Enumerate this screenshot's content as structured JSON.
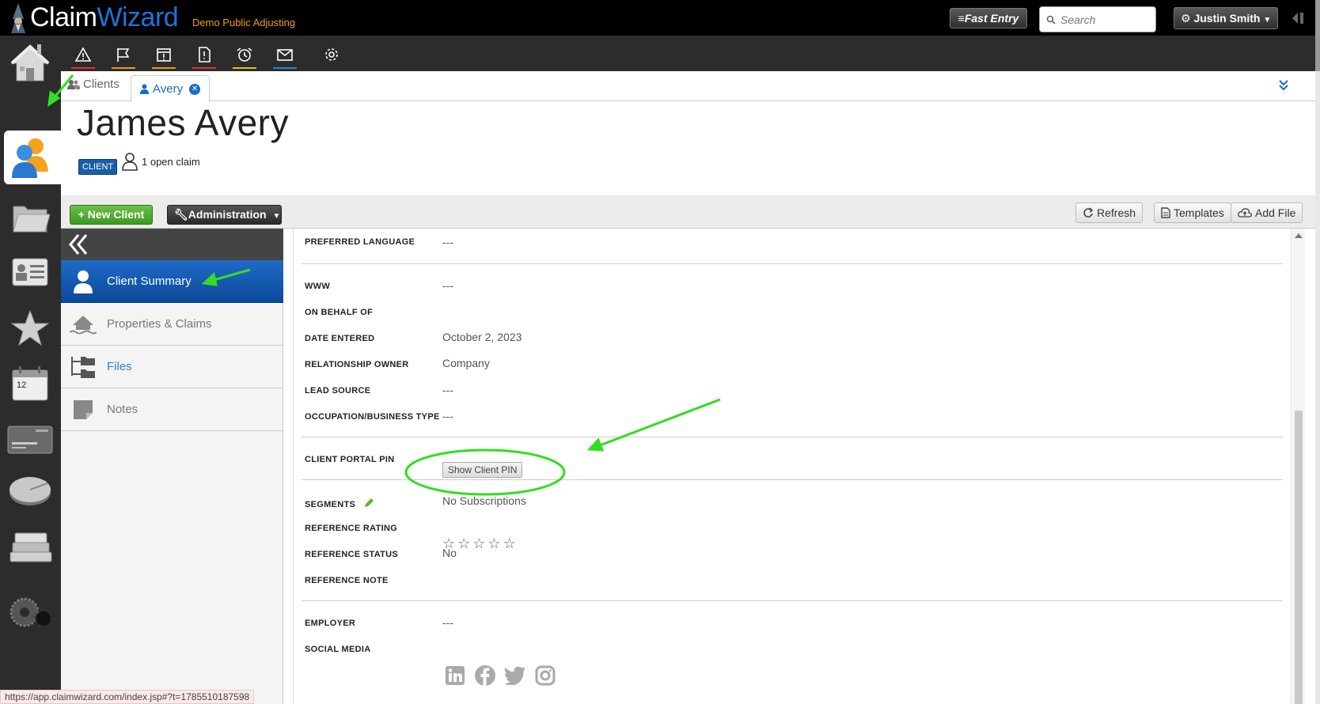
{
  "app": {
    "logo_part1": "Claim",
    "logo_part2": "Wizard",
    "tagline": "Demo Public Adjusting"
  },
  "topbar": {
    "fast_entry_label": "Fast Entry",
    "search_placeholder": "Search",
    "user_label": "Justin Smith"
  },
  "tabs": {
    "clients_label": "Clients",
    "avery_label": "Avery"
  },
  "client": {
    "name": "James Avery",
    "badge": "CLIENT",
    "open_claims": "1 open claim"
  },
  "actions": {
    "new_client": "+ New Client",
    "administration": "Administration",
    "refresh": "Refresh",
    "templates": "Templates",
    "add_file": "Add File"
  },
  "sidenav": {
    "items": [
      {
        "label": "Client Summary",
        "icon": "person-icon"
      },
      {
        "label": "Properties & Claims",
        "icon": "house-flood-icon"
      },
      {
        "label": "Files",
        "icon": "folder-tree-icon"
      },
      {
        "label": "Notes",
        "icon": "note-icon"
      }
    ]
  },
  "fields": {
    "preferred_language": {
      "label": "PREFERRED LANGUAGE",
      "value": "---"
    },
    "www": {
      "label": "WWW",
      "value": "---"
    },
    "on_behalf_of": {
      "label": "ON BEHALF OF",
      "value": ""
    },
    "date_entered": {
      "label": "DATE ENTERED",
      "value": "October 2, 2023"
    },
    "relationship_owner": {
      "label": "RELATIONSHIP OWNER",
      "value": "Company"
    },
    "lead_source": {
      "label": "LEAD SOURCE",
      "value": "---"
    },
    "occupation": {
      "label": "OCCUPATION/BUSINESS TYPE",
      "value": "---"
    },
    "client_portal_pin": {
      "label": "CLIENT PORTAL PIN",
      "button": "Show Client PIN"
    },
    "segments": {
      "label": "SEGMENTS",
      "value": "No Subscriptions"
    },
    "reference_rating": {
      "label": "REFERENCE RATING",
      "stars": 5,
      "rating": 0
    },
    "reference_status": {
      "label": "REFERENCE STATUS",
      "value": "No"
    },
    "reference_note": {
      "label": "REFERENCE NOTE",
      "value": ""
    },
    "employer": {
      "label": "EMPLOYER",
      "value": "---"
    },
    "social_media": {
      "label": "SOCIAL MEDIA",
      "icons": [
        "linkedin-icon",
        "facebook-icon",
        "twitter-icon",
        "instagram-icon"
      ]
    }
  },
  "status_url": "https://app.claimwizard.com/index.jsp#?t=1785510187598",
  "colors": {
    "accent_blue": "#1a6dbd",
    "new_button_green": "#4caf2c",
    "annotation_green": "#33dd22",
    "tagline_orange": "#f0a000"
  }
}
